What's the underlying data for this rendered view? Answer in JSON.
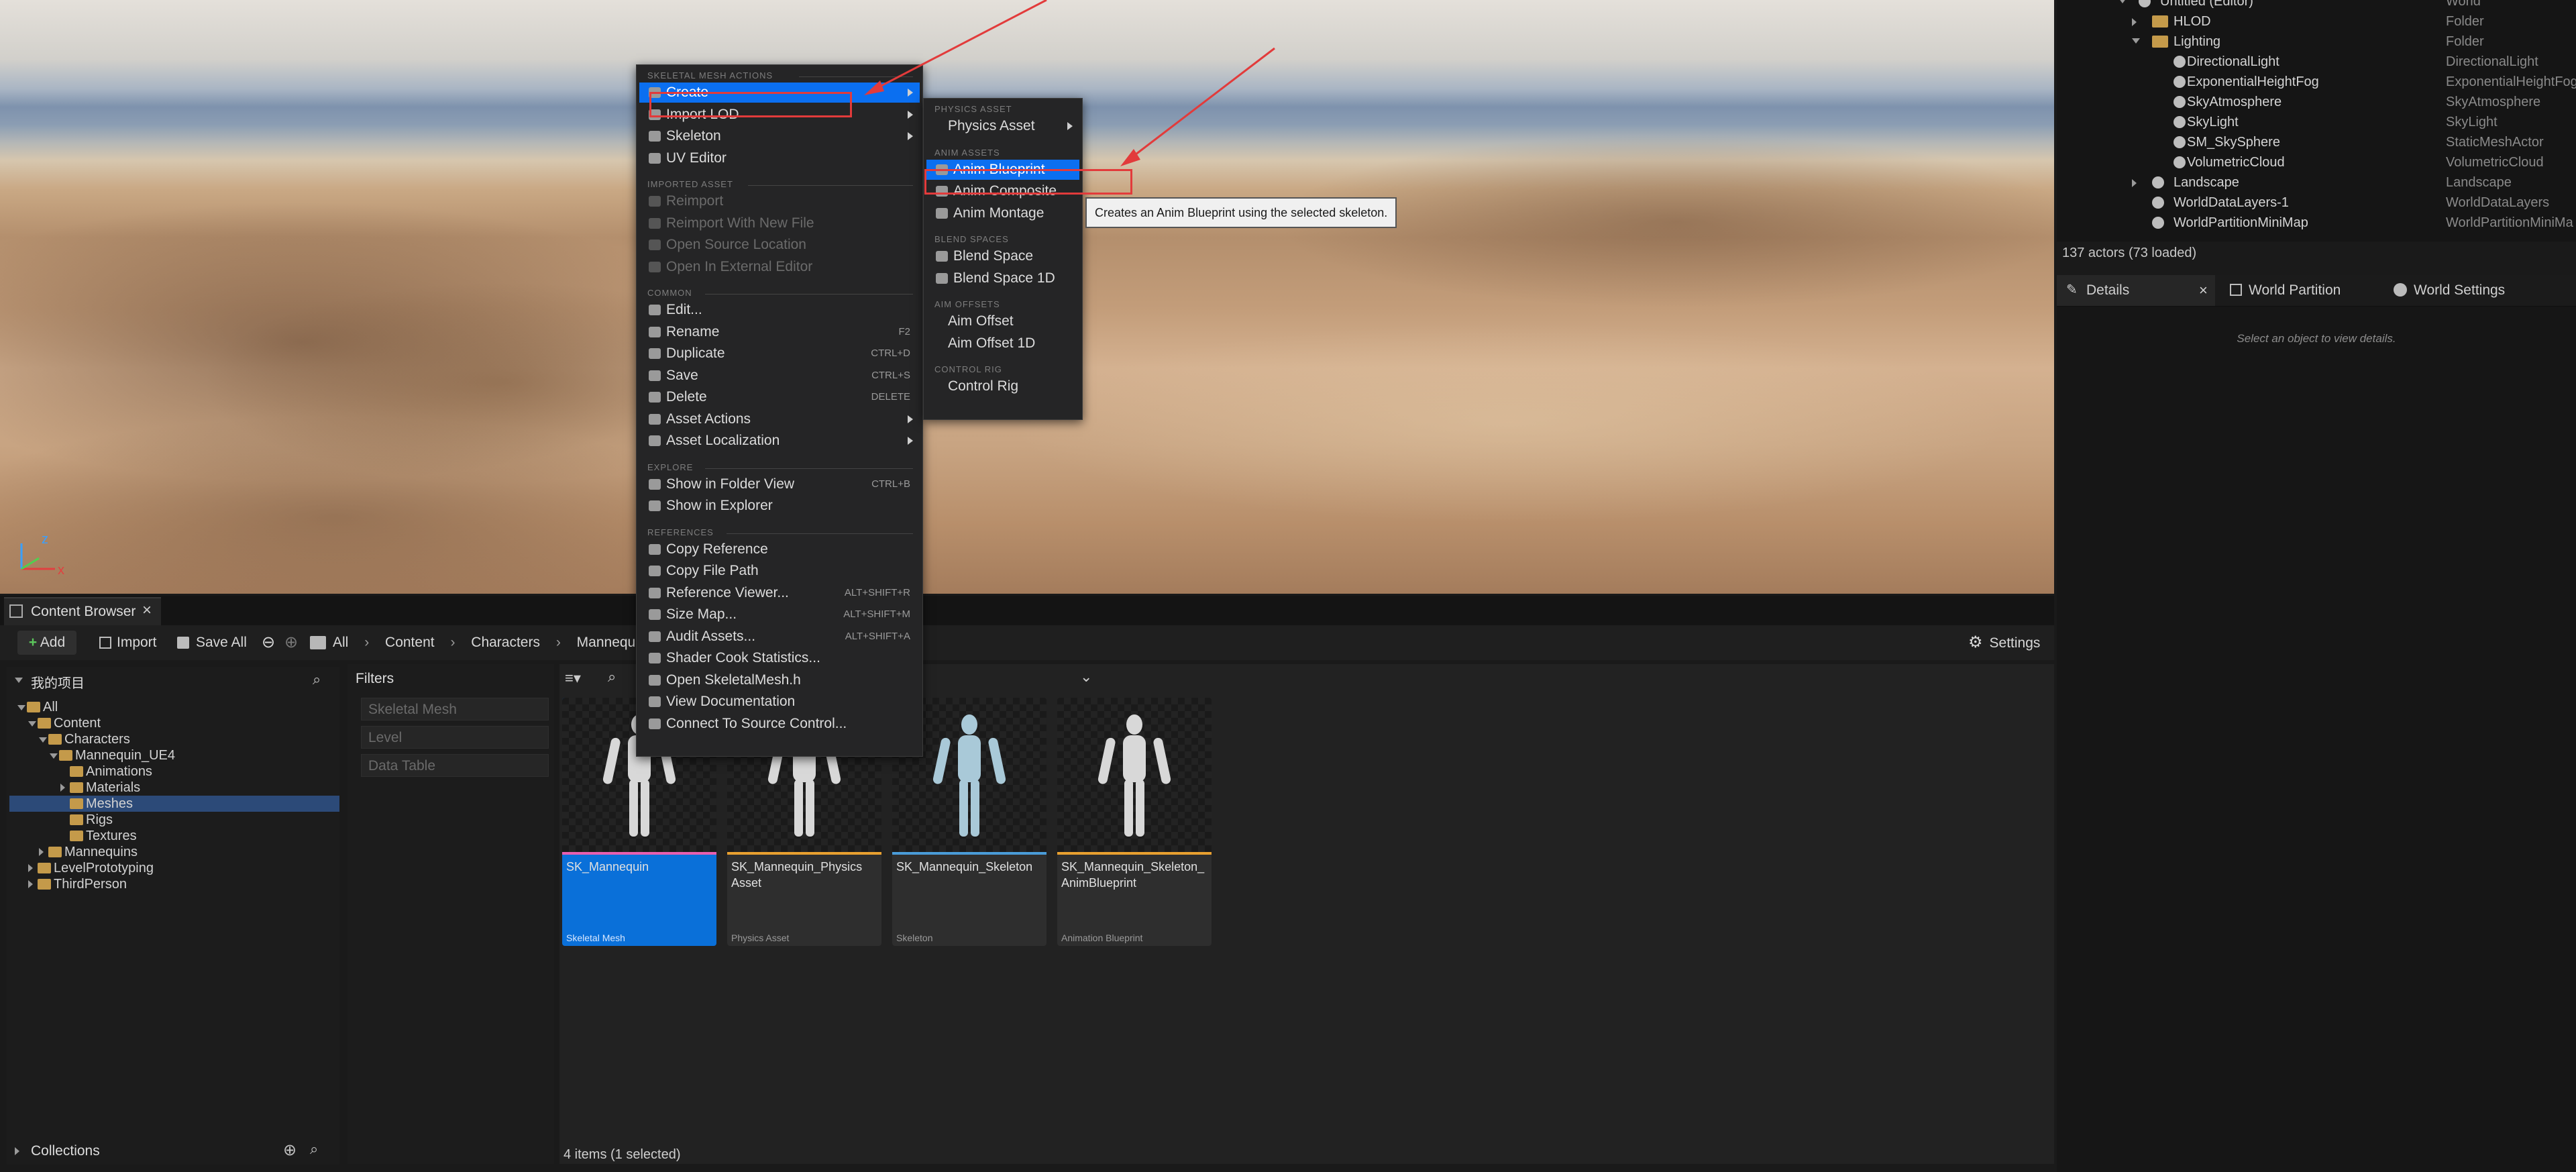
{
  "outliner": {
    "rows": [
      {
        "name": "Untitled (Editor)",
        "type": "World",
        "indent": 0,
        "icon": "world-icon"
      },
      {
        "name": "HLOD",
        "type": "Folder",
        "indent": 1,
        "icon": "folder-icon"
      },
      {
        "name": "Lighting",
        "type": "Folder",
        "indent": 1,
        "icon": "folder-icon"
      },
      {
        "name": "DirectionalLight",
        "type": "DirectionalLight",
        "indent": 2,
        "icon": "light-icon"
      },
      {
        "name": "ExponentialHeightFog",
        "type": "ExponentialHeightFog",
        "indent": 2,
        "icon": "fog-icon"
      },
      {
        "name": "SkyAtmosphere",
        "type": "SkyAtmosphere",
        "indent": 2,
        "icon": "atmosphere-icon"
      },
      {
        "name": "SkyLight",
        "type": "SkyLight",
        "indent": 2,
        "icon": "skylight-icon"
      },
      {
        "name": "SM_SkySphere",
        "type": "StaticMeshActor",
        "indent": 2,
        "icon": "mesh-icon"
      },
      {
        "name": "VolumetricCloud",
        "type": "VolumetricCloud",
        "indent": 2,
        "icon": "cloud-icon"
      },
      {
        "name": "Landscape",
        "type": "Landscape",
        "indent": 1,
        "icon": "landscape-icon"
      },
      {
        "name": "WorldDataLayers-1",
        "type": "WorldDataLayers",
        "indent": 1,
        "icon": "datalayer-icon"
      },
      {
        "name": "WorldPartitionMiniMap",
        "type": "WorldPartitionMiniMa",
        "indent": 1,
        "icon": "minimap-icon"
      }
    ],
    "actor_count": "137 actors (73 loaded)"
  },
  "details": {
    "tabs": [
      "Details",
      "World Partition",
      "World Settings"
    ],
    "empty_text": "Select an object to view details."
  },
  "content_browser": {
    "tab_label": "Content Browser",
    "toolbar": {
      "add": "Add",
      "import": "Import",
      "save_all": "Save All",
      "settings": "Settings"
    },
    "breadcrumbs": [
      "All",
      "Content",
      "Characters",
      "Mannequin_"
    ],
    "tree_header": "我的项目",
    "tree": [
      {
        "label": "All",
        "depth": 0,
        "expanded": true
      },
      {
        "label": "Content",
        "depth": 1,
        "expanded": true
      },
      {
        "label": "Characters",
        "depth": 2,
        "expanded": true
      },
      {
        "label": "Mannequin_UE4",
        "depth": 3,
        "expanded": true
      },
      {
        "label": "Animations",
        "depth": 4
      },
      {
        "label": "Materials",
        "depth": 4,
        "collapsed": true
      },
      {
        "label": "Meshes",
        "depth": 4,
        "selected": true
      },
      {
        "label": "Rigs",
        "depth": 4
      },
      {
        "label": "Textures",
        "depth": 4
      },
      {
        "label": "Mannequins",
        "depth": 2,
        "collapsed": true
      },
      {
        "label": "LevelPrototyping",
        "depth": 1,
        "collapsed": true
      },
      {
        "label": "ThirdPerson",
        "depth": 1,
        "collapsed": true
      }
    ],
    "collections": "Collections",
    "filters_title": "Filters",
    "filters": [
      "Skeletal Mesh",
      "Level",
      "Data Table"
    ],
    "assets": [
      {
        "name": "SK_Mannequin",
        "type": "Skeletal Mesh",
        "color": "#e85fb0",
        "selected": true
      },
      {
        "name": "SK_Mannequin_Physics Asset",
        "type": "Physics Asset",
        "color": "#e8a030"
      },
      {
        "name": "SK_Mannequin_Skeleton",
        "type": "Skeleton",
        "color": "#4a9cd8"
      },
      {
        "name": "SK_Mannequin_Skeleton_ AnimBlueprint",
        "type": "Animation Blueprint",
        "color": "#e8a030"
      }
    ],
    "status": "4 items (1 selected)"
  },
  "context_menu": {
    "sections": {
      "skeletal": "SKELETAL MESH ACTIONS",
      "imported": "IMPORTED ASSET",
      "common": "COMMON",
      "explore": "EXPLORE",
      "references": "REFERENCES"
    },
    "skeletal_items": [
      {
        "label": "Create",
        "submenu": true,
        "highlighted": true
      },
      {
        "label": "Import LOD",
        "submenu": true
      },
      {
        "label": "Skeleton",
        "submenu": true
      },
      {
        "label": "UV Editor"
      }
    ],
    "imported_items": [
      {
        "label": "Reimport",
        "disabled": true
      },
      {
        "label": "Reimport With New File",
        "disabled": true
      },
      {
        "label": "Open Source Location",
        "disabled": true
      },
      {
        "label": "Open In External Editor",
        "disabled": true
      }
    ],
    "common_items": [
      {
        "label": "Edit..."
      },
      {
        "label": "Rename",
        "shortcut": "F2"
      },
      {
        "label": "Duplicate",
        "shortcut": "CTRL+D"
      },
      {
        "label": "Save",
        "shortcut": "CTRL+S"
      },
      {
        "label": "Delete",
        "shortcut": "DELETE"
      },
      {
        "label": "Asset Actions",
        "submenu": true
      },
      {
        "label": "Asset Localization",
        "submenu": true
      }
    ],
    "explore_items": [
      {
        "label": "Show in Folder View",
        "shortcut": "CTRL+B"
      },
      {
        "label": "Show in Explorer"
      }
    ],
    "reference_items": [
      {
        "label": "Copy Reference"
      },
      {
        "label": "Copy File Path"
      },
      {
        "label": "Reference Viewer...",
        "shortcut": "ALT+SHIFT+R"
      },
      {
        "label": "Size Map...",
        "shortcut": "ALT+SHIFT+M"
      },
      {
        "label": "Audit Assets...",
        "shortcut": "ALT+SHIFT+A"
      },
      {
        "label": "Shader Cook Statistics..."
      },
      {
        "label": "Open SkeletalMesh.h"
      },
      {
        "label": "View Documentation"
      },
      {
        "label": "Connect To Source Control..."
      }
    ]
  },
  "sub_menu": {
    "sections": {
      "physics": "PHYSICS ASSET",
      "anim": "ANIM ASSETS",
      "blend": "BLEND SPACES",
      "aim": "AIM OFFSETS",
      "control": "CONTROL RIG"
    },
    "physics_items": [
      {
        "label": "Physics Asset",
        "submenu": true
      }
    ],
    "anim_items": [
      {
        "label": "Anim Blueprint",
        "highlighted": true
      },
      {
        "label": "Anim Composite"
      },
      {
        "label": "Anim Montage"
      }
    ],
    "blend_items": [
      {
        "label": "Blend Space"
      },
      {
        "label": "Blend Space 1D"
      }
    ],
    "aim_items": [
      {
        "label": "Aim Offset"
      },
      {
        "label": "Aim Offset 1D"
      }
    ],
    "control_items": [
      {
        "label": "Control Rig"
      }
    ]
  },
  "tooltip": "Creates an Anim Blueprint using the selected skeleton.",
  "colors": {
    "accent": "#0b6ff0",
    "annotation": "#e23b3b"
  }
}
